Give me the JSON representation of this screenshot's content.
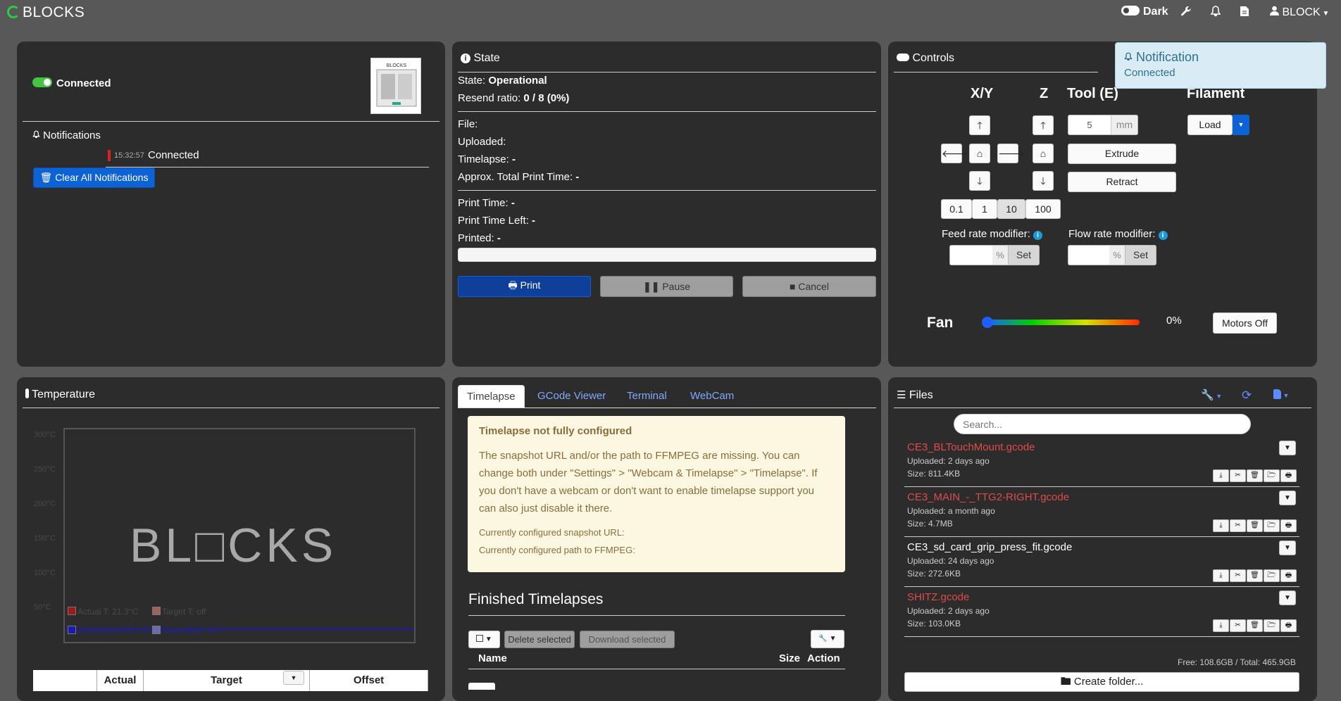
{
  "navbar": {
    "brand": "BLOCKS",
    "theme_label": "Dark",
    "user_label": "BLOCK"
  },
  "connection": {
    "status": "Connected",
    "notifications_title": "Notifications",
    "notification_time": "15:32:57",
    "notification_text": "Connected",
    "clear_button": "Clear All Notifications"
  },
  "state": {
    "title": "State",
    "state_label": "State:",
    "state_value": "Operational",
    "resend_label": "Resend ratio:",
    "resend_value": "0 / 8 (0%)",
    "file_label": "File:",
    "uploaded_label": "Uploaded:",
    "timelapse_label": "Timelapse:",
    "timelapse_value": "-",
    "approx_label": "Approx. Total Print Time:",
    "approx_value": "-",
    "print_time_label": "Print Time:",
    "print_time_value": "-",
    "time_left_label": "Print Time Left:",
    "time_left_value": "-",
    "printed_label": "Printed:",
    "printed_value": "-",
    "progress": 0,
    "print_button": "Print",
    "pause_button": "Pause",
    "cancel_button": "Cancel"
  },
  "controls": {
    "title": "Controls",
    "xy_label": "X/Y",
    "z_label": "Z",
    "tool_label": "Tool (E)",
    "filament_label": "Filament",
    "extrude_amount": "5",
    "extrude_unit": "mm",
    "extrude_button": "Extrude",
    "retract_button": "Retract",
    "load_button": "Load",
    "steps": [
      "0.1",
      "1",
      "10",
      "100"
    ],
    "active_step": "10",
    "feed_rate_label": "Feed rate modifier:",
    "flow_rate_label": "Flow rate modifier:",
    "percent_unit": "%",
    "set_button": "Set",
    "fan_label": "Fan",
    "fan_value": "0%",
    "motors_off_button": "Motors Off"
  },
  "notification_popup": {
    "title": "Notification",
    "text": "Connected"
  },
  "temperature": {
    "title": "Temperature",
    "y_ticks": [
      "300°C",
      "250°C",
      "200°C",
      "150°C",
      "100°C",
      "50°C"
    ],
    "legend": {
      "actual_tool": "Actual T: 21.3°C",
      "target_tool": "Target T: off",
      "actual_bed": "Actual Bed: 21.3°C",
      "target_bed": "Target Bed: off"
    },
    "watermark": "BL□CKS",
    "table_headers": {
      "actual": "Actual",
      "target": "Target",
      "offset": "Offset"
    }
  },
  "middle_tabs": {
    "tabs": [
      "Timelapse",
      "GCode Viewer",
      "Terminal",
      "WebCam"
    ],
    "warning_title": "Timelapse not fully configured",
    "warning_body": "The snapshot URL and/or the path to FFMPEG are missing. You can change both under \"Settings\" > \"Webcam & Timelapse\" > \"Timelapse\". If you don't have a webcam or don't want to enable timelapse support you can also just disable it there.",
    "snapshot_line": "Currently configured snapshot URL:",
    "ffmpeg_line": "Currently configured path to FFMPEG:",
    "finished_title": "Finished Timelapses",
    "delete_selected": "Delete selected",
    "download_selected": "Download selected",
    "col_name": "Name",
    "col_size": "Size",
    "col_action": "Action"
  },
  "files": {
    "title": "Files",
    "search_placeholder": "Search...",
    "items": [
      {
        "name": "CE3_BLTouchMount.gcode",
        "uploaded": "Uploaded: 2 days ago",
        "size": "Size: 811.4KB",
        "color": "#e04a4a"
      },
      {
        "name": "CE3_MAIN_-_TTG2-RIGHT.gcode",
        "uploaded": "Uploaded: a month ago",
        "size": "Size: 4.7MB",
        "color": "#e04a4a"
      },
      {
        "name": "CE3_sd_card_grip_press_fit.gcode",
        "uploaded": "Uploaded: 24 days ago",
        "size": "Size: 272.6KB",
        "color": "#ffffff"
      },
      {
        "name": "SHITZ.gcode",
        "uploaded": "Uploaded: 2 days ago",
        "size": "Size: 103.0KB",
        "color": "#e04a4a"
      }
    ],
    "storage": "Free: 108.6GB / Total: 465.9GB",
    "create_folder": "Create folder..."
  }
}
